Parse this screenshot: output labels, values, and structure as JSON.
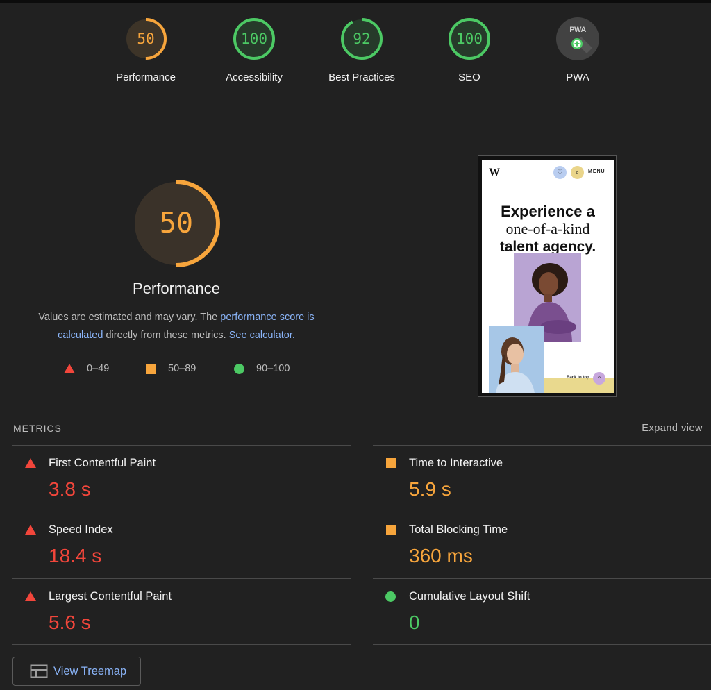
{
  "gauges": [
    {
      "label": "Performance",
      "score": "50",
      "fraction": 0.5,
      "color": "#f7a53c"
    },
    {
      "label": "Accessibility",
      "score": "100",
      "fraction": 1.0,
      "color": "#4cc964"
    },
    {
      "label": "Best Practices",
      "score": "92",
      "fraction": 0.92,
      "color": "#4cc964"
    },
    {
      "label": "SEO",
      "score": "100",
      "fraction": 1.0,
      "color": "#4cc964"
    },
    {
      "label": "PWA",
      "badge_text": "PWA",
      "icon": "pwa-plus-icon"
    }
  ],
  "performance": {
    "score": "50",
    "fraction": 0.5,
    "title": "Performance",
    "desc_pre": "Values are estimated and may vary. The ",
    "desc_link1": "performance score is calculated",
    "desc_mid": " directly from these metrics. ",
    "desc_link2": "See calculator."
  },
  "legend": [
    {
      "range": "0–49",
      "shape": "triangle",
      "color": "#f2463b"
    },
    {
      "range": "50–89",
      "shape": "square",
      "color": "#f7a53c"
    },
    {
      "range": "90–100",
      "shape": "circle",
      "color": "#4cc964"
    }
  ],
  "screenshot": {
    "logo": "W",
    "menu": "MENU",
    "heading_1": "Experience a",
    "heading_2": "one-of-a-kind",
    "heading_3": "talent agency.",
    "back_to_top": "Back to top"
  },
  "metrics": {
    "title": "METRICS",
    "expand": "Expand view",
    "items": [
      {
        "name": "First Contentful Paint",
        "value": "3.8 s",
        "rating": "fail"
      },
      {
        "name": "Time to Interactive",
        "value": "5.9 s",
        "rating": "average"
      },
      {
        "name": "Speed Index",
        "value": "18.4 s",
        "rating": "fail"
      },
      {
        "name": "Total Blocking Time",
        "value": "360 ms",
        "rating": "average"
      },
      {
        "name": "Largest Contentful Paint",
        "value": "5.6 s",
        "rating": "fail"
      },
      {
        "name": "Cumulative Layout Shift",
        "value": "0",
        "rating": "pass"
      }
    ]
  },
  "treemap": {
    "label": "View Treemap",
    "icon": "treemap-icon"
  },
  "colors": {
    "fail": "#f2463b",
    "average": "#f7a53c",
    "pass": "#4cc964",
    "link": "#8ab4f8",
    "background": "#212121"
  }
}
